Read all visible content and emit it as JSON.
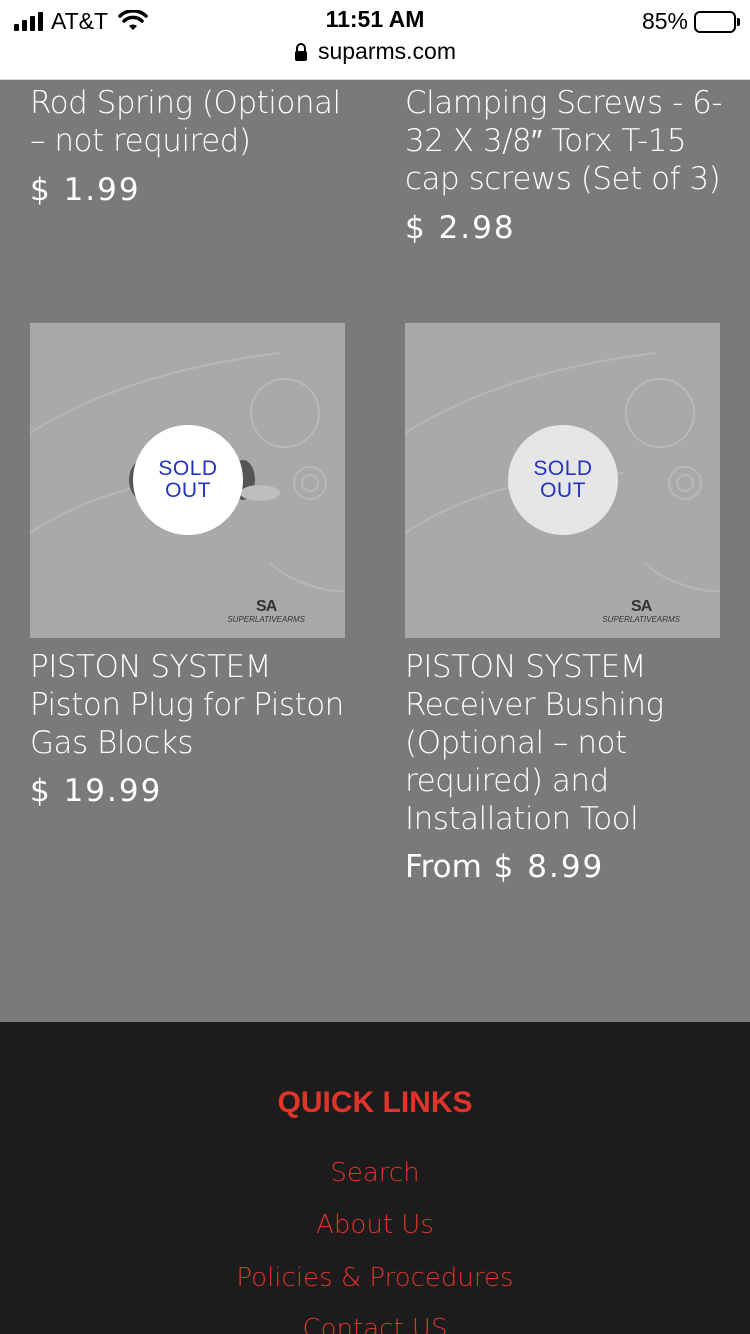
{
  "status_bar": {
    "carrier": "AT&T",
    "time": "11:51 AM",
    "battery": "85%",
    "battery_level": 0.85,
    "url": "suparms.com"
  },
  "products": [
    {
      "name": "Rod Spring (Optional – not required)",
      "price": "$ 1.99",
      "image": false
    },
    {
      "name": "Clamping Screws - 6-32 X 3/8″ Torx T-15 cap screws (Set of 3)",
      "price": "$ 2.98",
      "image": false
    },
    {
      "name_line1": "PISTON SYSTEM",
      "name_line2": "Piston Plug for Piston Gas Blocks",
      "price": "$ 19.99",
      "badge_line1": "SOLD",
      "badge_line2": "OUT",
      "brand": "SUPERLATIVEARMS"
    },
    {
      "name_line1": "PISTON SYSTEM",
      "name_line2": "Receiver Bushing (Optional – not required) and Installation Tool",
      "price_prefix": "From",
      "price": "$ 8.99",
      "badge_line1": "SOLD",
      "badge_line2": "OUT",
      "brand": "SUPERLATIVEARMS"
    }
  ],
  "footer": {
    "title": "QUICK LINKS",
    "links": [
      "Search",
      "About Us",
      "Policies & Procedures",
      "Contact US"
    ]
  },
  "colors": {
    "page_background": "#7a7a7a",
    "footer_background": "#1c1c1c",
    "accent": "#e0342a",
    "badge_text": "#2434c0"
  }
}
